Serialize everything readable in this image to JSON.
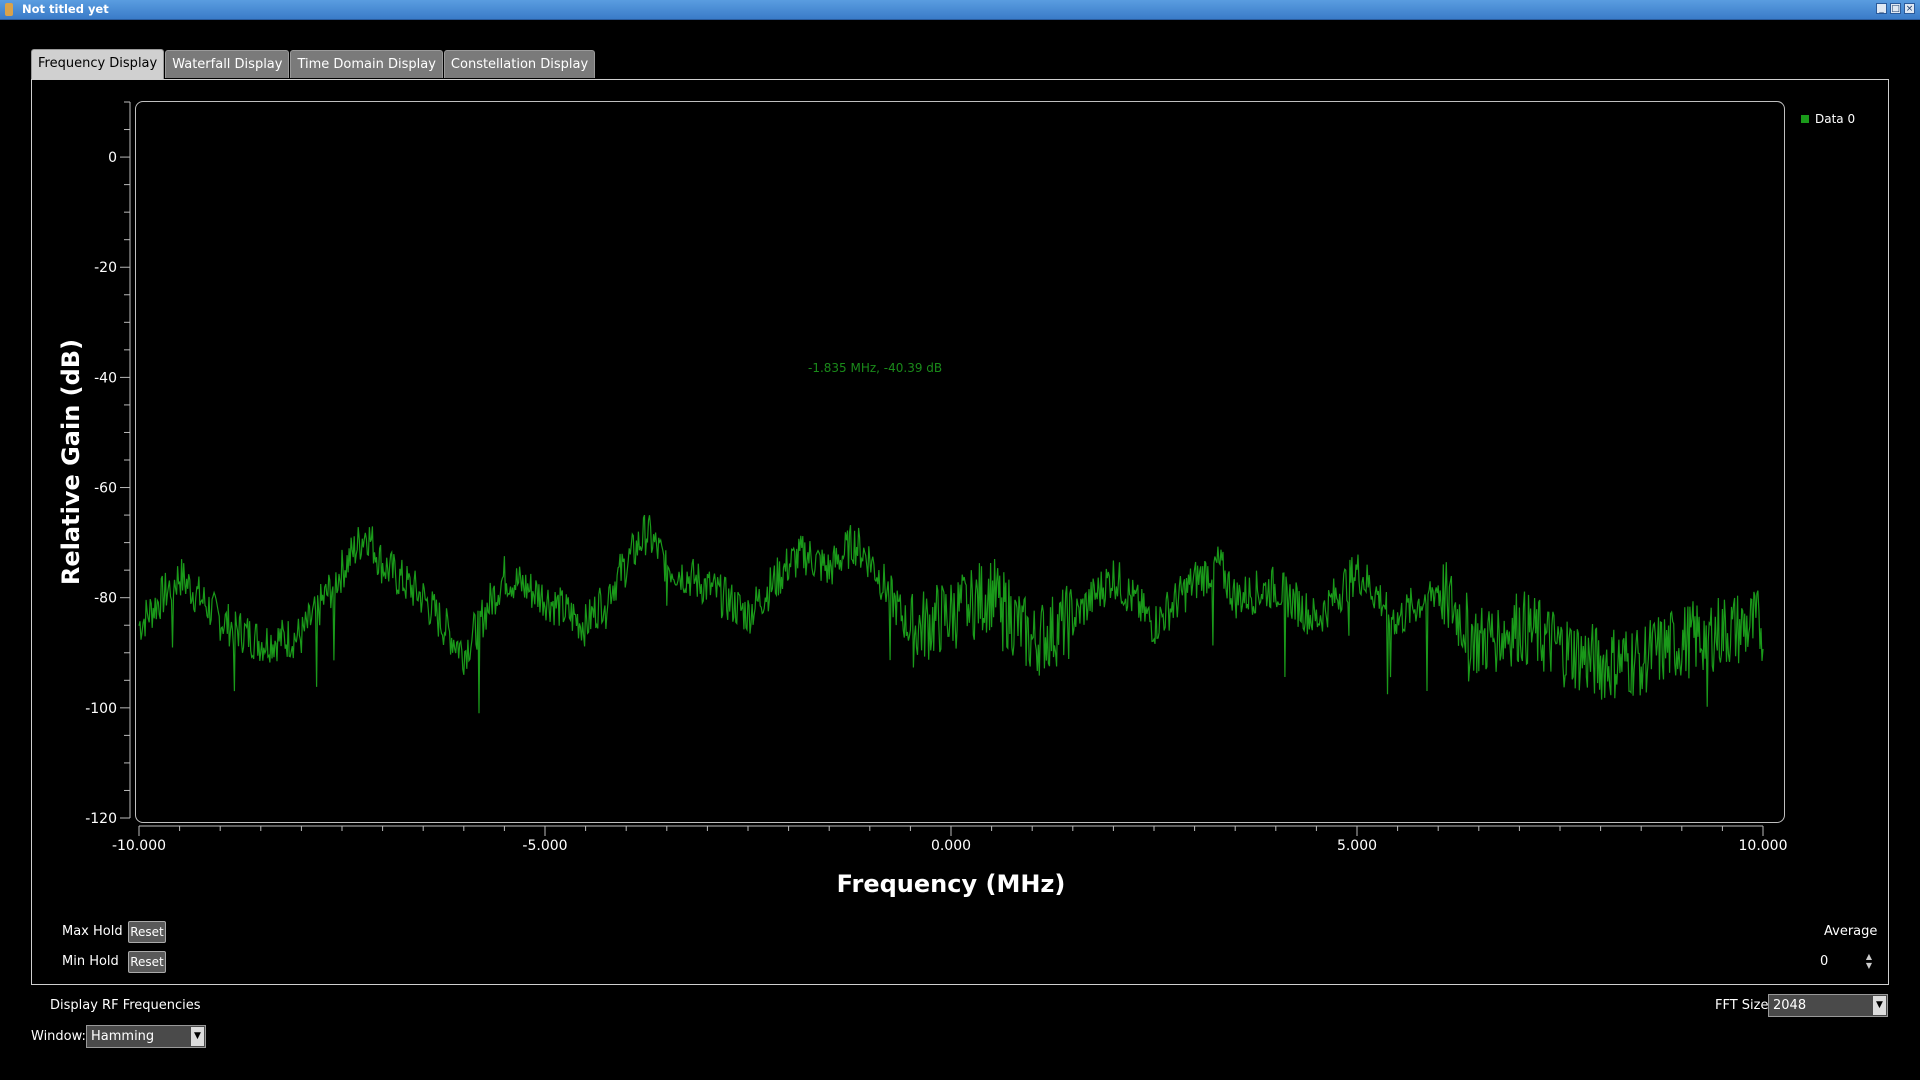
{
  "window": {
    "title": "Not titled yet"
  },
  "tabs": [
    "Frequency Display",
    "Waterfall Display",
    "Time Domain Display",
    "Constellation Display"
  ],
  "legend": {
    "label": "Data 0",
    "color": "#1a9a1a"
  },
  "marker": {
    "text": "-1.835 MHz, -40.39 dB"
  },
  "controls": {
    "max_hold_label": "Max Hold",
    "min_hold_label": "Min Hold",
    "reset_label": "Reset",
    "average_label": "Average",
    "average_value": "0",
    "display_rf_label": "Display RF Frequencies",
    "fft_size_label": "FFT Size:",
    "fft_size_value": "2048",
    "window_label": "Window:",
    "window_value": "Hamming"
  },
  "chart_data": {
    "type": "line",
    "xlabel": "Frequency (MHz)",
    "ylabel": "Relative Gain (dB)",
    "xlim": [
      -10,
      10
    ],
    "ylim": [
      -120,
      10
    ],
    "xticks": [
      "-10.000",
      "-5.000",
      "0.000",
      "5.000",
      "10.000"
    ],
    "yticks": [
      "0",
      "-20",
      "-40",
      "-60",
      "-80",
      "-100",
      "-120"
    ],
    "series": [
      {
        "name": "Data 0",
        "color": "#1a9a1a",
        "x": [
          -10,
          -9.5,
          -9,
          -8.5,
          -8,
          -7.5,
          -7.2,
          -7,
          -6.5,
          -6,
          -5.5,
          -5,
          -4.5,
          -4,
          -3.75,
          -3.5,
          -3,
          -2.5,
          -2,
          -1.8,
          -1.5,
          -1.2,
          -1,
          -0.5,
          0,
          0.5,
          1,
          1.5,
          2,
          2.5,
          3,
          3.3,
          3.5,
          4,
          4.5,
          5,
          5.5,
          6,
          6.5,
          7,
          7.5,
          8,
          8.5,
          9,
          9.5,
          10
        ],
        "y": [
          -85,
          -76,
          -84,
          -88,
          -87,
          -75,
          -68,
          -74,
          -80,
          -90,
          -76,
          -80,
          -85,
          -74,
          -68,
          -74,
          -78,
          -83,
          -74,
          -72,
          -75,
          -70,
          -73,
          -86,
          -83,
          -79,
          -88,
          -84,
          -76,
          -85,
          -77,
          -74,
          -80,
          -78,
          -84,
          -75,
          -84,
          -78,
          -88,
          -85,
          -89,
          -92,
          -91,
          -88,
          -86,
          -85
        ]
      }
    ]
  }
}
